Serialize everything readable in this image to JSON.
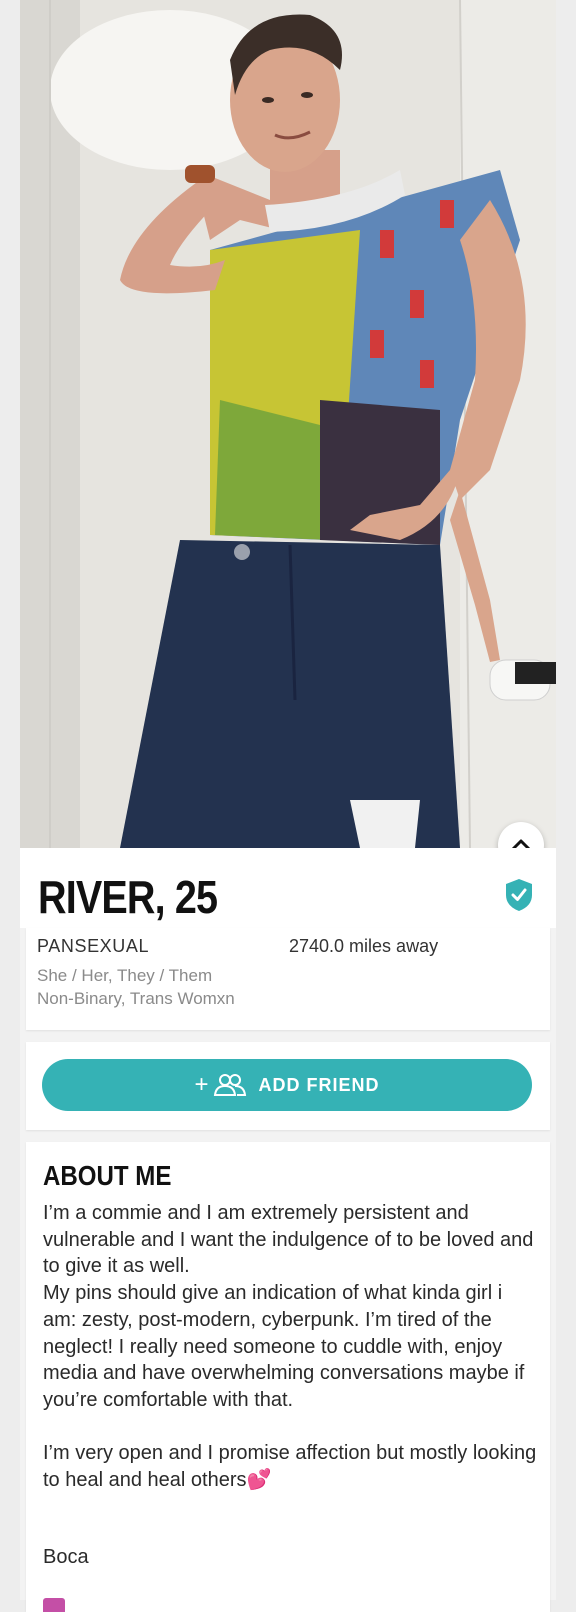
{
  "profile": {
    "name_age": "RIVER, 25",
    "orientation": "PANSEXUAL",
    "distance": "2740.0 miles away",
    "pronouns": "She / Her, They / Them",
    "gender": "Non-Binary, Trans Womxn",
    "verified": true
  },
  "actions": {
    "add_friend_label": "ADD FRIEND",
    "add_friend_prefix": "+"
  },
  "about": {
    "title": "ABOUT ME",
    "body": "I’m a commie and I am extremely persistent and vulnerable and I want the indulgence of to be loved and to give it as well.\nMy pins should give an indication of what kinda girl i am: zesty, post-modern, cyberpunk. I’m tired of the neglect! I really need someone to cuddle with, enjoy media and have overwhelming conversations maybe if you’re comfortable with that.\n\nI’m very open and I promise affection but mostly looking to heal and heal others",
    "heart_emoji": "💕",
    "location": "Boca"
  },
  "icons": {
    "collapse": "chevron-up-icon",
    "verified": "shield-check-icon",
    "add_friend": "add-user-icon"
  },
  "colors": {
    "accent": "#35b2b5",
    "name_text": "#111111",
    "secondary_text": "#8a8a8a"
  }
}
